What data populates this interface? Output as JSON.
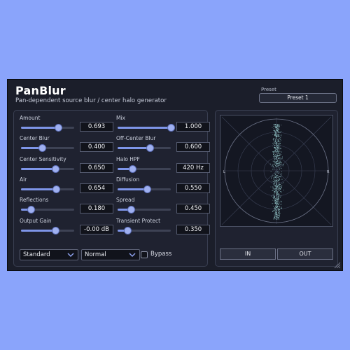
{
  "plugin": {
    "title": "PanBlur",
    "subtitle": "Pan-dependent source blur / center halo generator"
  },
  "preset": {
    "label": "Preset",
    "value": "Preset 1"
  },
  "params_left": [
    {
      "label": "Amount",
      "value": "0.693",
      "level": 0.693
    },
    {
      "label": "Center Blur",
      "value": "0.400",
      "level": 0.4
    },
    {
      "label": "Center Sensitivity",
      "value": "0.650",
      "level": 0.65
    },
    {
      "label": "Air",
      "value": "0.654",
      "level": 0.654
    },
    {
      "label": "Reflections",
      "value": "0.180",
      "level": 0.18
    },
    {
      "label": "Output Gain",
      "value": "-0.00 dB",
      "level": 0.64
    }
  ],
  "params_right": [
    {
      "label": "Mix",
      "value": "1.000",
      "level": 1.0
    },
    {
      "label": "Off-Center Blur",
      "value": "0.600",
      "level": 0.6
    },
    {
      "label": "Halo HPF",
      "value": "420 Hz",
      "level": 0.28
    },
    {
      "label": "Diffusion",
      "value": "0.550",
      "level": 0.55
    },
    {
      "label": "Spread",
      "value": "0.450",
      "level": 0.25
    },
    {
      "label": "Transient Protect",
      "value": "0.350",
      "level": 0.18
    }
  ],
  "controls": {
    "mode_dropdown": "Standard",
    "quality_dropdown": "Normal",
    "bypass_label": "Bypass"
  },
  "scope": {
    "left_label": "L",
    "right_label": "R"
  },
  "buttons": {
    "in_label": "IN",
    "out_label": "OUT"
  },
  "colors": {
    "accent": "#7e95e8",
    "background": "#8aa4fb",
    "panel": "#1b1e2a",
    "scope_dots": "#9fd6d8"
  }
}
